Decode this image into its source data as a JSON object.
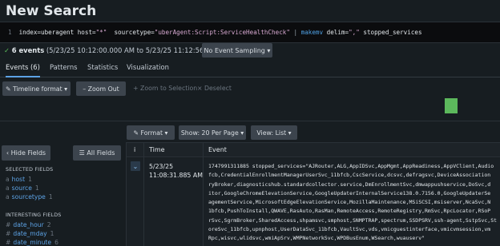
{
  "page": {
    "title": "New Search"
  },
  "search": {
    "line_number": "1",
    "query_plain_1": "index=uberagent host=",
    "query_str_1": "\"*\"",
    "query_plain_2": "  sourcetype=",
    "query_str_2": "\"uberAgent:Script:ServiceHealthCheck\"",
    "query_pipe": " | ",
    "query_cmd": "makemv",
    "query_plain_3": " delim=",
    "query_str_3": "\",\"",
    "query_args": " stopped_services"
  },
  "status": {
    "check": "✓",
    "count": "6 events",
    "range": " (5/23/25 10:12:00.000 AM to 5/23/25 11:12:56.000 AM)",
    "sampling": "No Event Sampling ▾"
  },
  "tabs": [
    {
      "label": "Events (6)",
      "active": true
    },
    {
      "label": "Patterns"
    },
    {
      "label": "Statistics"
    },
    {
      "label": "Visualization"
    }
  ],
  "timeline": {
    "format_btn": "✎ Timeline format ▾",
    "zoom_out": "– Zoom Out",
    "zoom_sel": "+ Zoom to Selection",
    "deselect": "× Deselect"
  },
  "results_toolbar": {
    "format": "✎ Format ▾",
    "per_page": "Show: 20 Per Page ▾",
    "view": "View: List ▾"
  },
  "left": {
    "hide_fields": "‹ Hide Fields",
    "all_fields": "☰ All Fields",
    "selected_head": "SELECTED FIELDS",
    "selected": [
      {
        "icon": "a",
        "name": "host",
        "count": "1"
      },
      {
        "icon": "a",
        "name": "source",
        "count": "1"
      },
      {
        "icon": "a",
        "name": "sourcetype",
        "count": "1"
      }
    ],
    "interesting_head": "INTERESTING FIELDS",
    "interesting": [
      {
        "icon": "#",
        "name": "date_hour",
        "count": "2"
      },
      {
        "icon": "#",
        "name": "date_mday",
        "count": "1"
      },
      {
        "icon": "#",
        "name": "date_minute",
        "count": "6"
      }
    ]
  },
  "table": {
    "col_i": "i",
    "col_time": "Time",
    "col_event": "Event",
    "row": {
      "expand": "⌄",
      "time_line1": "5/23/25",
      "time_line2": "11:08:31.885 AM",
      "event_lines": [
        "1747991311885 stopped_services=\"AJRouter,ALG,AppIDSvc,AppMgmt,AppReadiness,AppVClient,Audio",
        "fcb,CredentialEnrollmentManagerUserSvc_11bfcb,CscService,dcsvc,defragsvc,DeviceAssociation",
        "ryBroker,diagnosticshub.standardcollector.service,DmEnrollmentSvc,dmwappushservice,DoSvc,d",
        "itor,GoogleChromeElevationService,GoogleUpdaterInternalService138.0.7156.0,GoogleUpdaterSe",
        "agementService,MicrosoftEdgeElevationService,MozillaMaintenance,MSiSCSI,msiserver,NcaSvc,N",
        "1bfcb,PushToInstall,QWAVE,RasAuto,RasMan,RemoteAccess,RemoteRegistry,RmSvc,RpcLocator,RSoP",
        "rSvc,SgrmBroker,SharedAccess,shpamsvc,smphost,SNMPTRAP,spectrum,SSDPSRV,ssh-agent,SstpSvc,St",
        "oreSvc_11bfcb,upnphost,UserDataSvc_11bfcb,VaultSvc,vds,vmicguestinterface,vmicvmsession,vm",
        "Rpc,wisvc,wlidsvc,wmiApSrv,WMPNetworkSvc,WPDBusEnum,WSearch,wuauserv\""
      ]
    }
  }
}
